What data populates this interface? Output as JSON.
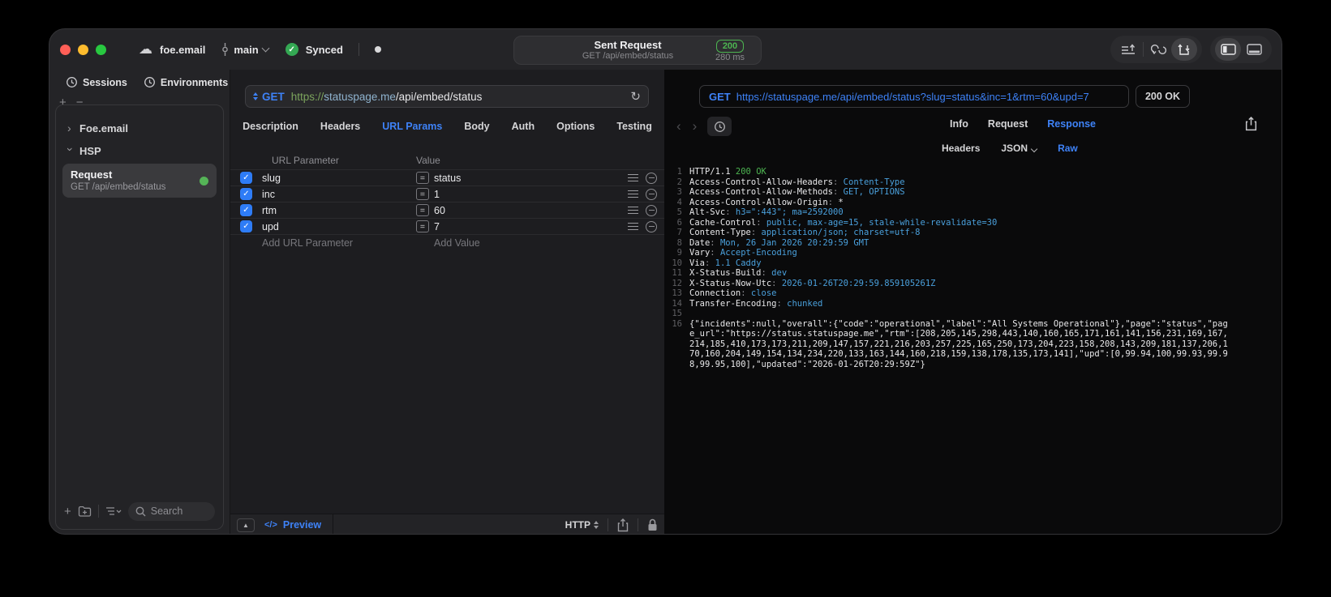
{
  "colors": {
    "accent_blue": "#3e82f7",
    "code_blue": "#4aa0dc",
    "success_green": "#4db551",
    "checkbox_blue": "#2e7cf6",
    "window_bg": "#242427",
    "middle_bg": "#1d1d20",
    "right_bg": "#0a0a0b"
  },
  "icons": {
    "cloud": "☁",
    "reload": "↻",
    "collapse_triangle": "▲",
    "check": "✓",
    "equals": "=",
    "code_tag": "</>",
    "back_arrow": "‹",
    "forward_arrow": "›",
    "tree_collapsed": "›",
    "tree_expanded": "›",
    "plus": "+",
    "minus": "−"
  },
  "titlebar": {
    "project": "foe.email",
    "branch": "main",
    "sync_status": "Synced",
    "center": {
      "title": "Sent Request",
      "subtitle": "GET /api/embed/status",
      "status_code": "200",
      "duration": "280 ms"
    }
  },
  "sidebar": {
    "tabs": [
      {
        "label": "Sessions",
        "active": true
      },
      {
        "label": "Environments",
        "active": false
      }
    ],
    "tree": [
      {
        "label": "Foe.email",
        "expanded": false
      },
      {
        "label": "HSP",
        "expanded": true
      }
    ],
    "request_item": {
      "title": "Request",
      "subtitle": "GET /api/embed/status",
      "selected": true
    },
    "search_placeholder": "Search"
  },
  "request_panel": {
    "method": "GET",
    "url_scheme": "https://",
    "url_host": "statuspage.me",
    "url_path": "/api/embed/status",
    "tabs": [
      {
        "label": "Description"
      },
      {
        "label": "Headers"
      },
      {
        "label": "URL Params",
        "active": true
      },
      {
        "label": "Body"
      },
      {
        "label": "Auth"
      },
      {
        "label": "Options"
      },
      {
        "label": "Testing"
      }
    ],
    "params_table": {
      "columns": {
        "name": "URL Parameter",
        "value": "Value"
      },
      "rows": [
        {
          "name": "slug",
          "value": "status",
          "enabled": true
        },
        {
          "name": "inc",
          "value": "1",
          "enabled": true
        },
        {
          "name": "rtm",
          "value": "60",
          "enabled": true
        },
        {
          "name": "upd",
          "value": "7",
          "enabled": true
        }
      ],
      "add_name_placeholder": "Add URL Parameter",
      "add_value_placeholder": "Add Value"
    },
    "footer": {
      "preview_label": "Preview",
      "protocol": "HTTP"
    }
  },
  "response_panel": {
    "request_line": {
      "method": "GET",
      "url": "https://statuspage.me/api/embed/status?slug=status&inc=1&rtm=60&upd=7"
    },
    "status": "200 OK",
    "tabs": [
      {
        "label": "Info"
      },
      {
        "label": "Request"
      },
      {
        "label": "Response",
        "active": true
      }
    ],
    "subtab_headers": "Headers",
    "subtab_json": "JSON",
    "subtab_raw": "Raw",
    "lines": [
      {
        "no": 1,
        "seg": [
          [
            "HTTP/1.1 ",
            "k"
          ],
          [
            "200 OK",
            "g"
          ]
        ]
      },
      {
        "no": 2,
        "seg": [
          [
            "Access-Control-Allow-Headers",
            "k"
          ],
          [
            ": ",
            "p"
          ],
          [
            "Content-Type",
            "v"
          ]
        ]
      },
      {
        "no": 3,
        "seg": [
          [
            "Access-Control-Allow-Methods",
            "k"
          ],
          [
            ": ",
            "p"
          ],
          [
            "GET, OPTIONS",
            "v"
          ]
        ]
      },
      {
        "no": 4,
        "seg": [
          [
            "Access-Control-Allow-Origin",
            "k"
          ],
          [
            ": ",
            "p"
          ],
          [
            "*",
            "k"
          ]
        ]
      },
      {
        "no": 5,
        "seg": [
          [
            "Alt-Svc",
            "k"
          ],
          [
            ": ",
            "p"
          ],
          [
            "h3=\":443\"; ma=2592000",
            "v"
          ]
        ]
      },
      {
        "no": 6,
        "seg": [
          [
            "Cache-Control",
            "k"
          ],
          [
            ": ",
            "p"
          ],
          [
            "public, max-age=15, stale-while-revalidate=30",
            "v"
          ]
        ]
      },
      {
        "no": 7,
        "seg": [
          [
            "Content-Type",
            "k"
          ],
          [
            ": ",
            "p"
          ],
          [
            "application/json; charset=utf-8",
            "v"
          ]
        ]
      },
      {
        "no": 8,
        "seg": [
          [
            "Date",
            "k"
          ],
          [
            ": ",
            "p"
          ],
          [
            "Mon, 26 Jan 2026 20:29:59 GMT",
            "v"
          ]
        ]
      },
      {
        "no": 9,
        "seg": [
          [
            "Vary",
            "k"
          ],
          [
            ": ",
            "p"
          ],
          [
            "Accept-Encoding",
            "v"
          ]
        ]
      },
      {
        "no": 10,
        "seg": [
          [
            "Via",
            "k"
          ],
          [
            ": ",
            "p"
          ],
          [
            "1.1 Caddy",
            "v"
          ]
        ]
      },
      {
        "no": 11,
        "seg": [
          [
            "X-Status-Build",
            "k"
          ],
          [
            ": ",
            "p"
          ],
          [
            "dev",
            "v"
          ]
        ]
      },
      {
        "no": 12,
        "seg": [
          [
            "X-Status-Now-Utc",
            "k"
          ],
          [
            ": ",
            "p"
          ],
          [
            "2026-01-26T20:29:59.859105261Z",
            "v"
          ]
        ]
      },
      {
        "no": 13,
        "seg": [
          [
            "Connection",
            "k"
          ],
          [
            ": ",
            "p"
          ],
          [
            "close",
            "v"
          ]
        ]
      },
      {
        "no": 14,
        "seg": [
          [
            "Transfer-Encoding",
            "k"
          ],
          [
            ": ",
            "p"
          ],
          [
            "chunked",
            "v"
          ]
        ]
      },
      {
        "no": 15,
        "seg": []
      },
      {
        "no": 16,
        "seg": [
          [
            "{\"incidents\":null,\"overall\":{\"code\":\"operational\",\"label\":\"All Systems Operational\"},\"page\":\"status\",\"page_url\":\"https://status.statuspage.me\",\"rtm\":[208,205,145,298,443,140,160,165,171,161,141,156,231,169,167,214,185,410,173,173,211,209,147,157,221,216,203,257,225,165,250,173,204,223,158,208,143,209,181,137,206,170,160,204,149,154,134,234,220,133,163,144,160,218,159,138,178,135,173,141],\"upd\":[0,99.94,100,99.93,99.98,99.95,100],\"updated\":\"2026-01-26T20:29:59Z\"}",
            "k"
          ]
        ]
      }
    ]
  }
}
